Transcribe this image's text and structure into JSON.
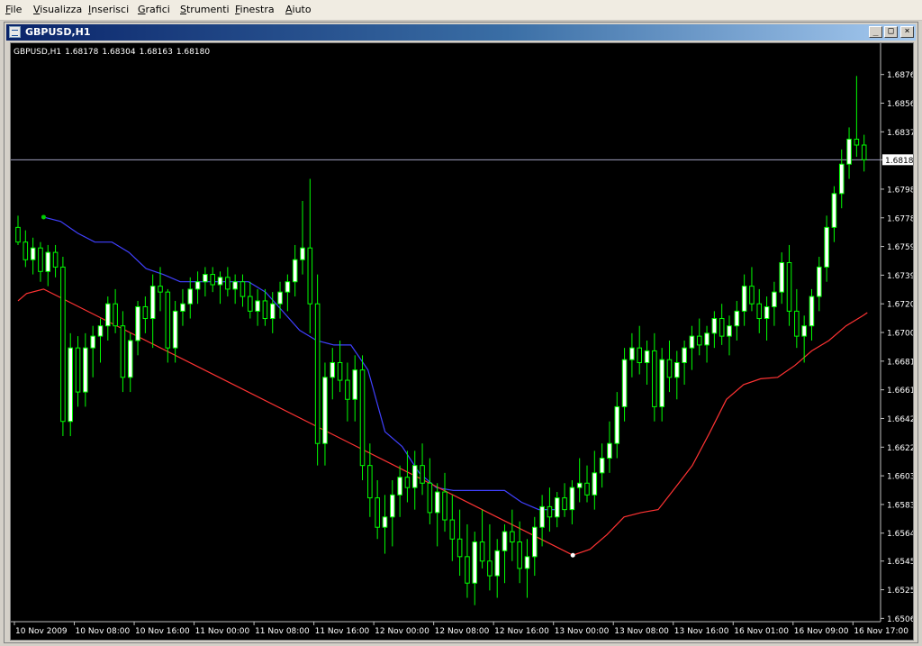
{
  "menu": [
    "File",
    "Visualizza",
    "Inserisci",
    "Grafici",
    "Strumenti",
    "Finestra",
    "Aiuto"
  ],
  "window": {
    "title": "GBPUSD,H1",
    "buttons": {
      "minimize": "_",
      "maximize": "□",
      "close": "×"
    }
  },
  "info": {
    "symbol": "GBPUSD,H1",
    "open": "1.68178",
    "high": "1.68304",
    "low": "1.68163",
    "close": "1.68180"
  },
  "colors": {
    "background": "#000000",
    "bull": "#ffffff",
    "bear": "#000000",
    "candle_outline": "#00ff00",
    "upper_line": "#4040ff",
    "lower_line": "#ff3333",
    "price_line": "#a0a0c0",
    "axis_text": "#ffffff"
  },
  "chart_data": {
    "type": "candlestick",
    "symbol": "GBPUSD,H1",
    "ylim": [
      1.6505,
      1.6885
    ],
    "y_ticks": [
      "1.68760",
      "1.68565",
      "1.68370",
      "1.68180",
      "1.67980",
      "1.67785",
      "1.67590",
      "1.67395",
      "1.67200",
      "1.67005",
      "1.66810",
      "1.66615",
      "1.66420",
      "1.66225",
      "1.66030",
      "1.65835",
      "1.65640",
      "1.65450",
      "1.65255",
      "1.65060"
    ],
    "current_price": "1.68180",
    "x_ticks": [
      "10 Nov 2009",
      "10 Nov 08:00",
      "10 Nov 16:00",
      "11 Nov 00:00",
      "11 Nov 08:00",
      "11 Nov 16:00",
      "12 Nov 00:00",
      "12 Nov 08:00",
      "12 Nov 16:00",
      "13 Nov 00:00",
      "13 Nov 08:00",
      "13 Nov 16:00",
      "16 Nov 01:00",
      "16 Nov 09:00",
      "16 Nov 17:00"
    ],
    "series": [
      {
        "name": "upper_trailing_stop",
        "values": [
          [
            6,
            1.6779
          ],
          [
            10,
            1.6776
          ],
          [
            14,
            1.6768
          ],
          [
            18,
            1.6762
          ],
          [
            22,
            1.6762
          ],
          [
            26,
            1.6755
          ],
          [
            30,
            1.6744
          ],
          [
            34,
            1.674
          ],
          [
            38,
            1.6735
          ],
          [
            42,
            1.6735
          ],
          [
            46,
            1.6735
          ],
          [
            50,
            1.6735
          ],
          [
            54,
            1.6735
          ],
          [
            58,
            1.6728
          ],
          [
            62,
            1.6715
          ],
          [
            66,
            1.6702
          ],
          [
            70,
            1.6695
          ],
          [
            74,
            1.6692
          ],
          [
            78,
            1.6692
          ],
          [
            82,
            1.6675
          ],
          [
            86,
            1.6633
          ],
          [
            90,
            1.6623
          ],
          [
            94,
            1.6605
          ],
          [
            98,
            1.6595
          ],
          [
            102,
            1.6593
          ],
          [
            106,
            1.6593
          ],
          [
            110,
            1.6593
          ],
          [
            114,
            1.6593
          ],
          [
            118,
            1.6585
          ],
          [
            122,
            1.658
          ],
          [
            126,
            1.658
          ]
        ]
      },
      {
        "name": "lower_trailing_stop",
        "values": [
          [
            0,
            1.6722
          ],
          [
            2,
            1.6727
          ],
          [
            6,
            1.673
          ],
          [
            130,
            1.6549
          ],
          [
            134,
            1.6553
          ],
          [
            138,
            1.6563
          ],
          [
            142,
            1.6575
          ],
          [
            146,
            1.6578
          ],
          [
            150,
            1.658
          ],
          [
            154,
            1.6595
          ],
          [
            158,
            1.661
          ],
          [
            162,
            1.6632
          ],
          [
            166,
            1.6655
          ],
          [
            170,
            1.6665
          ],
          [
            174,
            1.6669
          ],
          [
            178,
            1.667
          ],
          [
            182,
            1.6678
          ],
          [
            186,
            1.6688
          ],
          [
            190,
            1.6695
          ],
          [
            194,
            1.6705
          ],
          [
            198,
            1.6712
          ],
          [
            199,
            1.6714
          ]
        ]
      }
    ],
    "candles": [
      [
        1.6772,
        1.678,
        1.676,
        1.6762
      ],
      [
        1.6762,
        1.677,
        1.6745,
        1.675
      ],
      [
        1.675,
        1.6765,
        1.674,
        1.6758
      ],
      [
        1.6758,
        1.6762,
        1.6735,
        1.6742
      ],
      [
        1.6742,
        1.676,
        1.6732,
        1.6755
      ],
      [
        1.6755,
        1.676,
        1.6738,
        1.6745
      ],
      [
        1.6745,
        1.6752,
        1.663,
        1.664
      ],
      [
        1.664,
        1.67,
        1.663,
        1.669
      ],
      [
        1.669,
        1.6698,
        1.665,
        1.666
      ],
      [
        1.666,
        1.67,
        1.665,
        1.669
      ],
      [
        1.669,
        1.6705,
        1.667,
        1.6698
      ],
      [
        1.6698,
        1.671,
        1.668,
        1.6705
      ],
      [
        1.6705,
        1.6725,
        1.6695,
        1.672
      ],
      [
        1.672,
        1.673,
        1.67,
        1.6705
      ],
      [
        1.6705,
        1.6715,
        1.666,
        1.667
      ],
      [
        1.667,
        1.67,
        1.666,
        1.6695
      ],
      [
        1.6695,
        1.6722,
        1.6685,
        1.6718
      ],
      [
        1.6718,
        1.6725,
        1.67,
        1.671
      ],
      [
        1.671,
        1.674,
        1.669,
        1.6732
      ],
      [
        1.6732,
        1.6745,
        1.6715,
        1.6728
      ],
      [
        1.6728,
        1.673,
        1.668,
        1.669
      ],
      [
        1.669,
        1.6722,
        1.668,
        1.6715
      ],
      [
        1.6715,
        1.673,
        1.6705,
        1.672
      ],
      [
        1.672,
        1.6738,
        1.671,
        1.673
      ],
      [
        1.673,
        1.6742,
        1.672,
        1.6735
      ],
      [
        1.6735,
        1.6745,
        1.6725,
        1.674
      ],
      [
        1.674,
        1.6745,
        1.6728,
        1.6733
      ],
      [
        1.6733,
        1.6742,
        1.672,
        1.6738
      ],
      [
        1.6738,
        1.6745,
        1.6725,
        1.673
      ],
      [
        1.673,
        1.674,
        1.672,
        1.6735
      ],
      [
        1.6735,
        1.674,
        1.6718,
        1.6725
      ],
      [
        1.6725,
        1.6735,
        1.671,
        1.6715
      ],
      [
        1.6715,
        1.673,
        1.6705,
        1.6722
      ],
      [
        1.6722,
        1.673,
        1.6705,
        1.671
      ],
      [
        1.671,
        1.6728,
        1.67,
        1.672
      ],
      [
        1.672,
        1.6735,
        1.671,
        1.6728
      ],
      [
        1.6728,
        1.674,
        1.6715,
        1.6735
      ],
      [
        1.6735,
        1.676,
        1.6725,
        1.675
      ],
      [
        1.675,
        1.679,
        1.674,
        1.6758
      ],
      [
        1.6758,
        1.6805,
        1.67,
        1.672
      ],
      [
        1.672,
        1.674,
        1.661,
        1.6625
      ],
      [
        1.6625,
        1.668,
        1.661,
        1.667
      ],
      [
        1.667,
        1.669,
        1.6655,
        1.668
      ],
      [
        1.668,
        1.6695,
        1.666,
        1.6668
      ],
      [
        1.6668,
        1.668,
        1.664,
        1.6655
      ],
      [
        1.6655,
        1.6685,
        1.664,
        1.6675
      ],
      [
        1.6675,
        1.6685,
        1.66,
        1.661
      ],
      [
        1.661,
        1.6625,
        1.6575,
        1.6588
      ],
      [
        1.6588,
        1.66,
        1.656,
        1.6568
      ],
      [
        1.6568,
        1.659,
        1.655,
        1.6575
      ],
      [
        1.6575,
        1.66,
        1.6555,
        1.659
      ],
      [
        1.659,
        1.661,
        1.6575,
        1.6602
      ],
      [
        1.6602,
        1.662,
        1.6585,
        1.6595
      ],
      [
        1.6595,
        1.662,
        1.658,
        1.661
      ],
      [
        1.661,
        1.6625,
        1.659,
        1.6598
      ],
      [
        1.6598,
        1.6615,
        1.657,
        1.6578
      ],
      [
        1.6578,
        1.6598,
        1.6555,
        1.6592
      ],
      [
        1.6592,
        1.6605,
        1.6565,
        1.6573
      ],
      [
        1.6573,
        1.659,
        1.6545,
        1.656
      ],
      [
        1.656,
        1.658,
        1.6535,
        1.6548
      ],
      [
        1.6548,
        1.657,
        1.652,
        1.653
      ],
      [
        1.653,
        1.6565,
        1.6515,
        1.6558
      ],
      [
        1.6558,
        1.658,
        1.654,
        1.6545
      ],
      [
        1.6545,
        1.657,
        1.6525,
        1.6535
      ],
      [
        1.6535,
        1.656,
        1.652,
        1.6552
      ],
      [
        1.6552,
        1.657,
        1.653,
        1.6565
      ],
      [
        1.6565,
        1.658,
        1.6545,
        1.6558
      ],
      [
        1.6558,
        1.6572,
        1.653,
        1.654
      ],
      [
        1.654,
        1.656,
        1.652,
        1.6548
      ],
      [
        1.6548,
        1.6575,
        1.6535,
        1.6568
      ],
      [
        1.6568,
        1.659,
        1.6555,
        1.6582
      ],
      [
        1.6582,
        1.6595,
        1.6565,
        1.6575
      ],
      [
        1.6575,
        1.6592,
        1.6568,
        1.6588
      ],
      [
        1.6588,
        1.6598,
        1.6575,
        1.658
      ],
      [
        1.658,
        1.66,
        1.657,
        1.6595
      ],
      [
        1.6595,
        1.6615,
        1.6585,
        1.6598
      ],
      [
        1.6598,
        1.661,
        1.6585,
        1.659
      ],
      [
        1.659,
        1.662,
        1.658,
        1.6605
      ],
      [
        1.6605,
        1.6625,
        1.6595,
        1.6615
      ],
      [
        1.6615,
        1.664,
        1.6605,
        1.6625
      ],
      [
        1.6625,
        1.666,
        1.6615,
        1.665
      ],
      [
        1.665,
        1.669,
        1.664,
        1.6682
      ],
      [
        1.6682,
        1.67,
        1.667,
        1.669
      ],
      [
        1.669,
        1.6705,
        1.6672,
        1.668
      ],
      [
        1.668,
        1.6695,
        1.6665,
        1.6688
      ],
      [
        1.6688,
        1.67,
        1.664,
        1.665
      ],
      [
        1.665,
        1.669,
        1.664,
        1.6682
      ],
      [
        1.6682,
        1.6695,
        1.666,
        1.667
      ],
      [
        1.667,
        1.6688,
        1.6655,
        1.668
      ],
      [
        1.668,
        1.6695,
        1.6665,
        1.669
      ],
      [
        1.669,
        1.6705,
        1.6675,
        1.6698
      ],
      [
        1.6698,
        1.671,
        1.6685,
        1.6692
      ],
      [
        1.6692,
        1.6705,
        1.668,
        1.67
      ],
      [
        1.67,
        1.6715,
        1.669,
        1.671
      ],
      [
        1.671,
        1.672,
        1.6692,
        1.6698
      ],
      [
        1.6698,
        1.6712,
        1.6685,
        1.6705
      ],
      [
        1.6705,
        1.6722,
        1.6695,
        1.6715
      ],
      [
        1.6715,
        1.674,
        1.6705,
        1.6732
      ],
      [
        1.6732,
        1.6745,
        1.6715,
        1.672
      ],
      [
        1.672,
        1.673,
        1.67,
        1.671
      ],
      [
        1.671,
        1.6725,
        1.6695,
        1.6718
      ],
      [
        1.6718,
        1.6735,
        1.6705,
        1.6728
      ],
      [
        1.6728,
        1.6755,
        1.672,
        1.6748
      ],
      [
        1.6748,
        1.676,
        1.6705,
        1.6715
      ],
      [
        1.6715,
        1.673,
        1.669,
        1.6698
      ],
      [
        1.6698,
        1.6712,
        1.668,
        1.6705
      ],
      [
        1.6705,
        1.673,
        1.6695,
        1.6725
      ],
      [
        1.6725,
        1.6752,
        1.6715,
        1.6745
      ],
      [
        1.6745,
        1.678,
        1.6735,
        1.6772
      ],
      [
        1.6772,
        1.68,
        1.6762,
        1.6795
      ],
      [
        1.6795,
        1.6825,
        1.6785,
        1.6815
      ],
      [
        1.6815,
        1.684,
        1.6805,
        1.6832
      ],
      [
        1.6832,
        1.6875,
        1.682,
        1.6828
      ],
      [
        1.6828,
        1.6835,
        1.681,
        1.6818
      ]
    ]
  }
}
